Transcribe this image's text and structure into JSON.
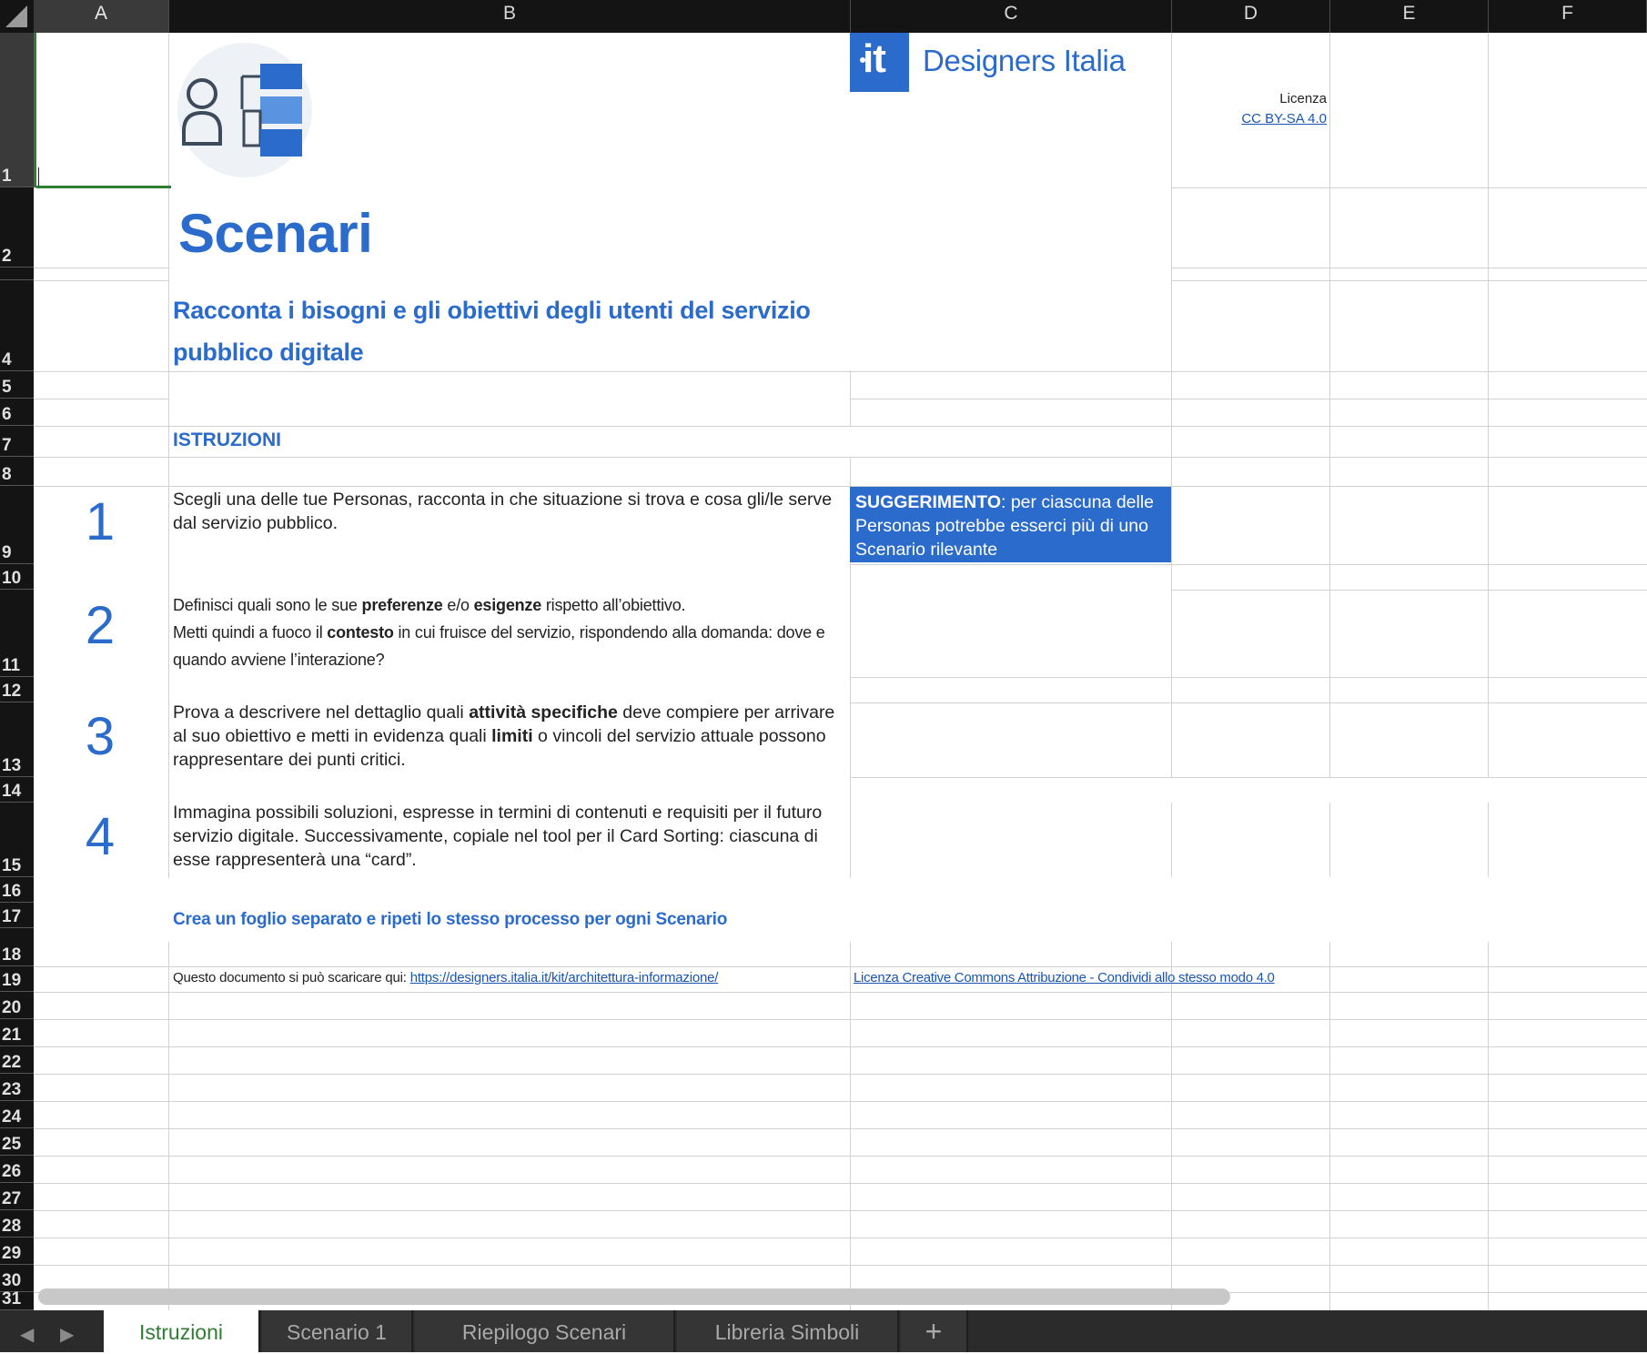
{
  "columns": [
    "A",
    "B",
    "C",
    "D",
    "E",
    "F"
  ],
  "rows": [
    "1",
    "2",
    "4",
    "5",
    "6",
    "7",
    "8",
    "9",
    "10",
    "11",
    "12",
    "13",
    "14",
    "15",
    "16",
    "17",
    "18",
    "19",
    "20",
    "21",
    "22",
    "23",
    "24",
    "25",
    "26",
    "27",
    "28",
    "29",
    "30",
    "31"
  ],
  "header": {
    "title": "Scenari",
    "subtitle": "Racconta i bisogni e gli obiettivi degli utenti del servizio pubblico digitale",
    "brand": "Designers Italia",
    "brand_mark": "it",
    "license_label": "Licenza",
    "license_link": "CC BY-SA 4.0"
  },
  "instructions": {
    "heading": "ISTRUZIONI",
    "steps": [
      {
        "number": "1"
      },
      {
        "number": "2"
      },
      {
        "number": "3"
      },
      {
        "number": "4"
      }
    ],
    "step1": {
      "text": "Scegli una delle tue Personas, racconta in che situazione si trova e cosa gli/le serve dal servizio pubblico."
    },
    "step2": {
      "a": "Definisci quali sono le sue ",
      "b": "preferenze",
      "c": " e/o ",
      "d": "esigenze",
      "e": " rispetto all’obiettivo.",
      "f": "Metti quindi a fuoco il ",
      "g": "contesto",
      "h": " in cui fruisce del servizio, rispondendo alla domanda: dove e quando avviene l’interazione?"
    },
    "step3": {
      "a": "Prova a descrivere nel dettaglio quali ",
      "b": "attività specifiche",
      "c": " deve compiere per arrivare al suo obiettivo e metti in evidenza quali ",
      "d": "limiti",
      "e": " o vincoli del servizio attuale possono rappresentare dei punti critici."
    },
    "step4": {
      "text": "Immagina possibili soluzioni, espresse in termini di contenuti e requisiti per il futuro servizio digitale. Successivamente, copiale nel tool per il Card Sorting: ciascuna di esse rappresenterà una “card”."
    },
    "tip": {
      "label": "SUGGERIMENTO",
      "text": ": per ciascuna delle Personas potrebbe esserci più di uno Scenario rilevante"
    },
    "repeat_note": "Crea un foglio separato e ripeti lo stesso processo per ogni Scenario"
  },
  "footer": {
    "download_text": "Questo documento si può scaricare qui: ",
    "download_url": "https://designers.italia.it/kit/architettura-informazione/",
    "cc_license": "Licenza Creative Commons Attribuzione - Condividi allo stesso modo 4.0"
  },
  "tabs": [
    {
      "label": "Istruzioni",
      "active": true
    },
    {
      "label": "Scenario 1",
      "active": false
    },
    {
      "label": "Riepilogo Scenari",
      "active": false
    },
    {
      "label": "Libreria Simboli",
      "active": false
    }
  ],
  "add_sheet_label": "+",
  "colors": {
    "accent": "#2a6bcb",
    "selection": "#2e7d32",
    "header_bg": "#141414"
  }
}
